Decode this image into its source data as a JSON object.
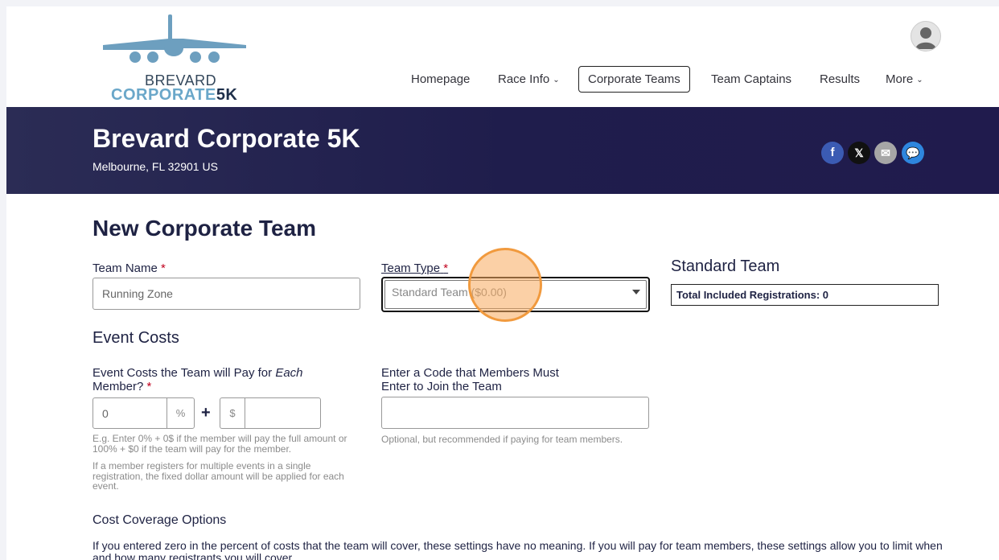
{
  "logo": {
    "line1": "BREVARD",
    "line2a": "CORPORATE",
    "line2b": "5K"
  },
  "nav": {
    "items": [
      "Homepage",
      "Race Info",
      "Corporate Teams",
      "Team Captains",
      "Results",
      "More"
    ],
    "active": "Corporate Teams"
  },
  "banner": {
    "title": "Brevard Corporate 5K",
    "location": "Melbourne, FL 32901 US",
    "social_icons": [
      "facebook-icon",
      "x-icon",
      "email-icon",
      "chat-icon"
    ]
  },
  "form": {
    "heading": "New Corporate Team",
    "team_name_label": "Team Name",
    "team_name_value": "Running Zone",
    "team_type_label": "Team Type",
    "team_type_value": "Standard Team ($0.00)",
    "required_mark": "*",
    "standard_title": "Standard Team",
    "total_registrations": "Total Included Registrations: 0",
    "event_costs_heading": "Event Costs",
    "cost_label_a": "Event Costs the Team will Pay for ",
    "cost_label_em": "Each",
    "cost_label_b": "Member?",
    "percent_value": "0",
    "percent_symbol": "%",
    "plus": "+",
    "dollar_symbol": "$",
    "cost_help_1": "E.g. Enter 0% + 0$ if the member will pay the full amount or 100% + $0 if the team will pay for the member.",
    "cost_help_2": "If a member registers for multiple events in a single registration, the fixed dollar amount will be applied for each event.",
    "code_label_1": "Enter a Code that Members Must",
    "code_label_2": "Enter to Join the Team",
    "code_value": "",
    "code_help": "Optional, but recommended if paying for team members.",
    "coverage_heading": "Cost Coverage Options",
    "coverage_text": "If you entered zero in the percent of costs that the team will cover, these settings have no meaning. If you will pay for team members, these settings allow you to limit when and how many registrants you will cover."
  },
  "colors": {
    "banner": "#1f1d4c",
    "heading": "#1e2243",
    "required": "#c0001d",
    "ripple": "#f19a3e"
  }
}
